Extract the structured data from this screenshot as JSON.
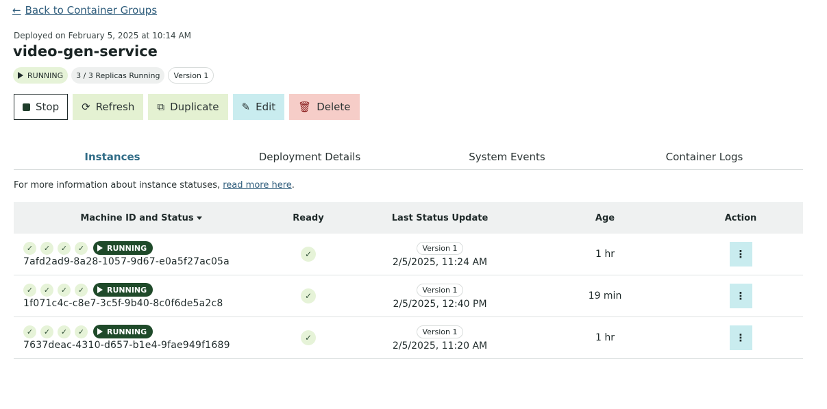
{
  "nav": {
    "back_label": "Back to Container Groups"
  },
  "deployment": {
    "deployed_on": "Deployed on February 5, 2025 at 10:14 AM",
    "name": "video-gen-service",
    "status": "RUNNING",
    "replicas": "3 / 3 Replicas Running",
    "version": "Version 1"
  },
  "buttons": {
    "stop": "Stop",
    "refresh": "Refresh",
    "duplicate": "Duplicate",
    "edit": "Edit",
    "delete": "Delete"
  },
  "tabs": [
    "Instances",
    "Deployment Details",
    "System Events",
    "Container Logs"
  ],
  "info": {
    "text": "For more information about instance statuses, ",
    "link": "read more here",
    "suffix": "."
  },
  "table": {
    "headers": [
      "Machine ID and Status",
      "Ready",
      "Last Status Update",
      "Age",
      "Action"
    ],
    "rows": [
      {
        "status": "RUNNING",
        "machine_id": "7afd2ad9-8a28-1057-9d67-e0a5f27ac05a",
        "version": "Version 1",
        "updated": "2/5/2025, 11:24 AM",
        "age": "1 hr"
      },
      {
        "status": "RUNNING",
        "machine_id": "1f071c4c-c8e7-3c5f-9b40-8c0f6de5a2c8",
        "version": "Version 1",
        "updated": "2/5/2025, 12:40 PM",
        "age": "19 min"
      },
      {
        "status": "RUNNING",
        "machine_id": "7637deac-4310-d657-b1e4-9fae949f1689",
        "version": "Version 1",
        "updated": "2/5/2025, 11:20 AM",
        "age": "1 hr"
      }
    ]
  },
  "icons": {
    "back": "arrow-left-icon",
    "play": "play-icon",
    "stop": "stop-icon",
    "refresh": "refresh-icon",
    "duplicate": "copy-icon",
    "edit": "edit-icon",
    "delete": "trash-icon",
    "check": "check-icon",
    "more": "more-vertical-icon",
    "sort": "caret-down-icon"
  },
  "colors": {
    "accent": "#2f6b86",
    "running_dark": "#1f4a2a",
    "running_light": "#e6f3d8",
    "edit_bg": "#c9ecef",
    "delete_bg": "#f6cdc8"
  }
}
